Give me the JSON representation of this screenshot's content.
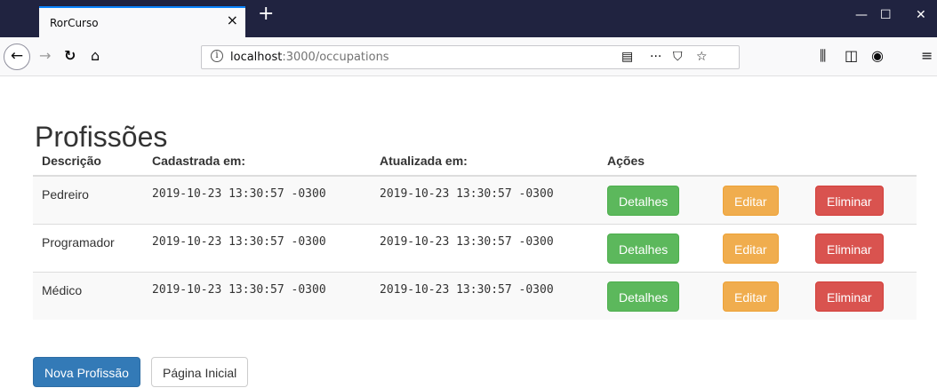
{
  "browser": {
    "tab_title": "RorCurso",
    "tab_close": "×",
    "new_tab": "+",
    "url_host": "localhost",
    "url_path": ":3000/occupations",
    "info": "i",
    "window_controls": {
      "minimize": "—",
      "maximize": "☐",
      "close": "✕"
    }
  },
  "page": {
    "title": "Profissões",
    "table": {
      "headers": [
        "Descrição",
        "Cadastrada em:",
        "Atualizada em:",
        "Ações"
      ],
      "rows": [
        {
          "descricao": "Pedreiro",
          "cadastrada": "2019-10-23 13:30:57 -0300",
          "atualizada": "2019-10-23 13:30:57 -0300"
        },
        {
          "descricao": "Programador",
          "cadastrada": "2019-10-23 13:30:57 -0300",
          "atualizada": "2019-10-23 13:30:57 -0300"
        },
        {
          "descricao": "Médico",
          "cadastrada": "2019-10-23 13:30:57 -0300",
          "atualizada": "2019-10-23 13:30:57 -0300"
        }
      ],
      "action_labels": {
        "details": "Detalhes",
        "edit": "Editar",
        "delete": "Eliminar"
      }
    },
    "footer_buttons": {
      "new": "Nova Profissão",
      "home": "Página Inicial"
    }
  },
  "colors": {
    "success": "#5cb85c",
    "warning": "#f0ad4e",
    "danger": "#d9534f",
    "primary": "#337ab7"
  }
}
